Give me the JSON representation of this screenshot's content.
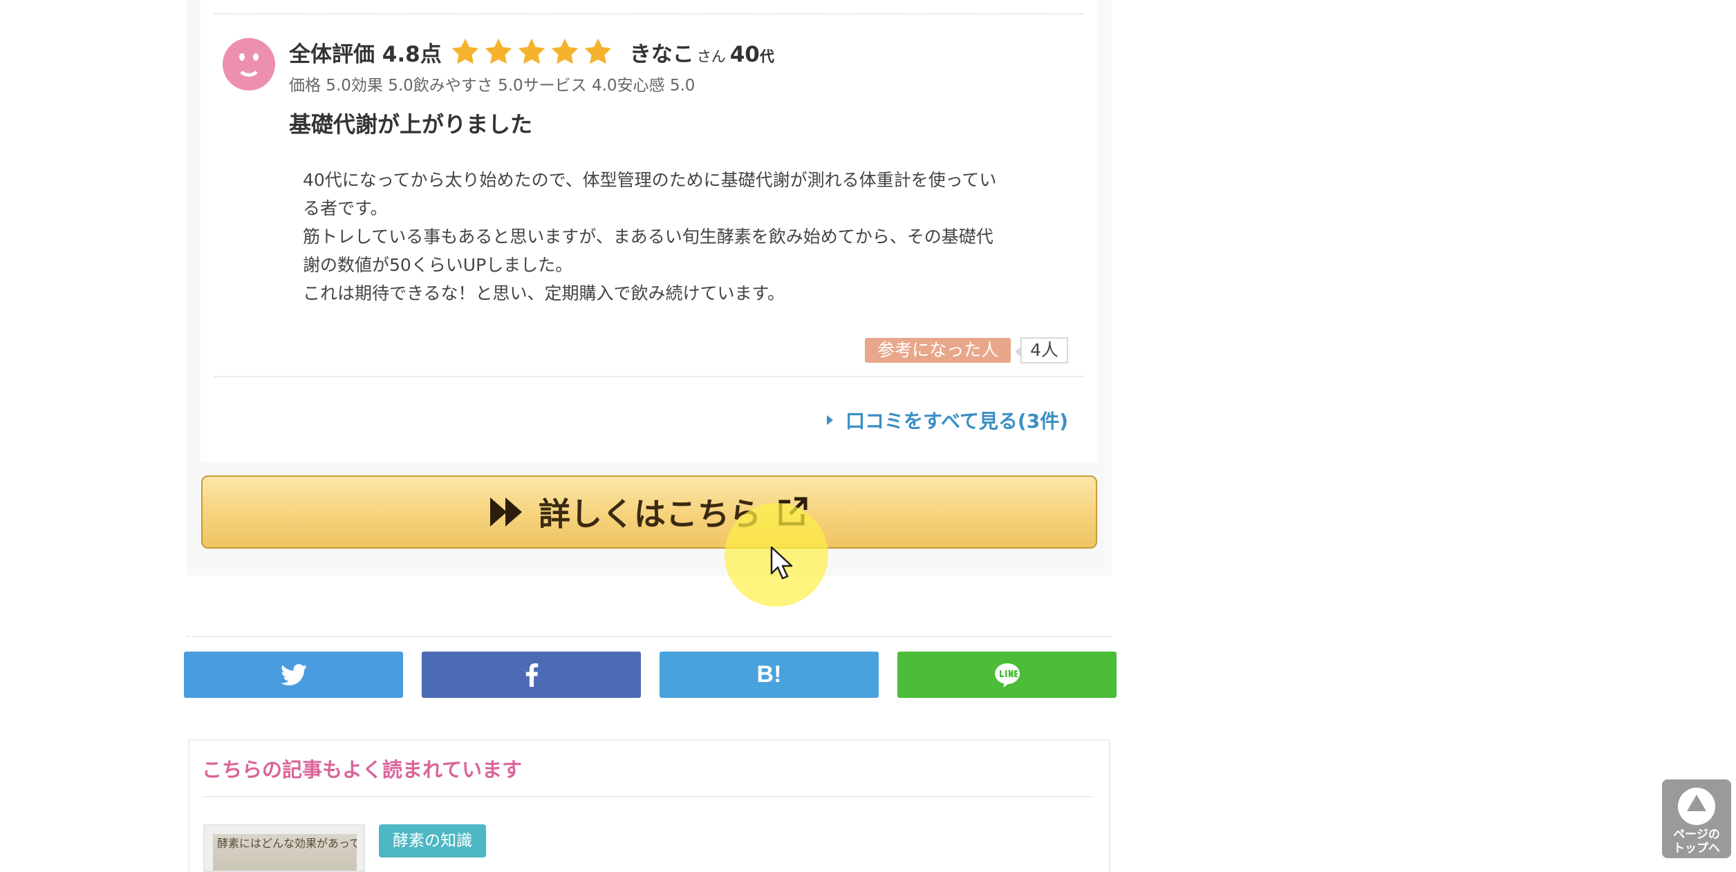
{
  "review": {
    "rating_label": "全体評価 4.8点",
    "rating": 4.8,
    "stars_max": 5,
    "star_color": "#f5b22d",
    "reviewer_name": "きなこ",
    "reviewer_honorific": "さん",
    "reviewer_age": "40",
    "reviewer_age_suffix": "代",
    "sub_scores": "価格 5.0効果 5.0飲みやすさ 5.0サービス 4.0安心感 5.0",
    "title": "基礎代謝が上がりました",
    "body": [
      "40代になってから太り始めたので、体型管理のために基礎代謝が測れる体重計を使ってい",
      "る者です。",
      "筋トレしている事もあると思いますが、まあるい旬生酵素を飲み始めてから、その基礎代",
      "謝の数値が50くらいUPしました。",
      "これは期待できるな！と思い、定期購入で飲み続けています。"
    ],
    "helpful_label": "参考になった人",
    "helpful_count": "4人",
    "see_all_link": "口コミをすべて見る(3件)"
  },
  "cta": {
    "label": "詳しくはこちら",
    "color": "#f6d27c"
  },
  "share": {
    "buttons": [
      {
        "name": "twitter",
        "icon": "twitter-bird-icon",
        "color": "#4a9ce0"
      },
      {
        "name": "facebook",
        "icon": "facebook-f-icon",
        "color": "#4d6bb4"
      },
      {
        "name": "hatena",
        "icon": "hatena-bookmark-icon",
        "label": "B!",
        "color": "#4aa2dc"
      },
      {
        "name": "line",
        "icon": "line-bubble-icon",
        "color": "#4cbc39"
      }
    ]
  },
  "related": {
    "title": "こちらの記事もよく読まれています",
    "thumb_caption": "酵素にはどんな効果があって体の中でどんな働きをするの？",
    "category": "酵素の知識"
  },
  "back_to_top": {
    "line1": "ページの",
    "line2": "トップへ"
  }
}
